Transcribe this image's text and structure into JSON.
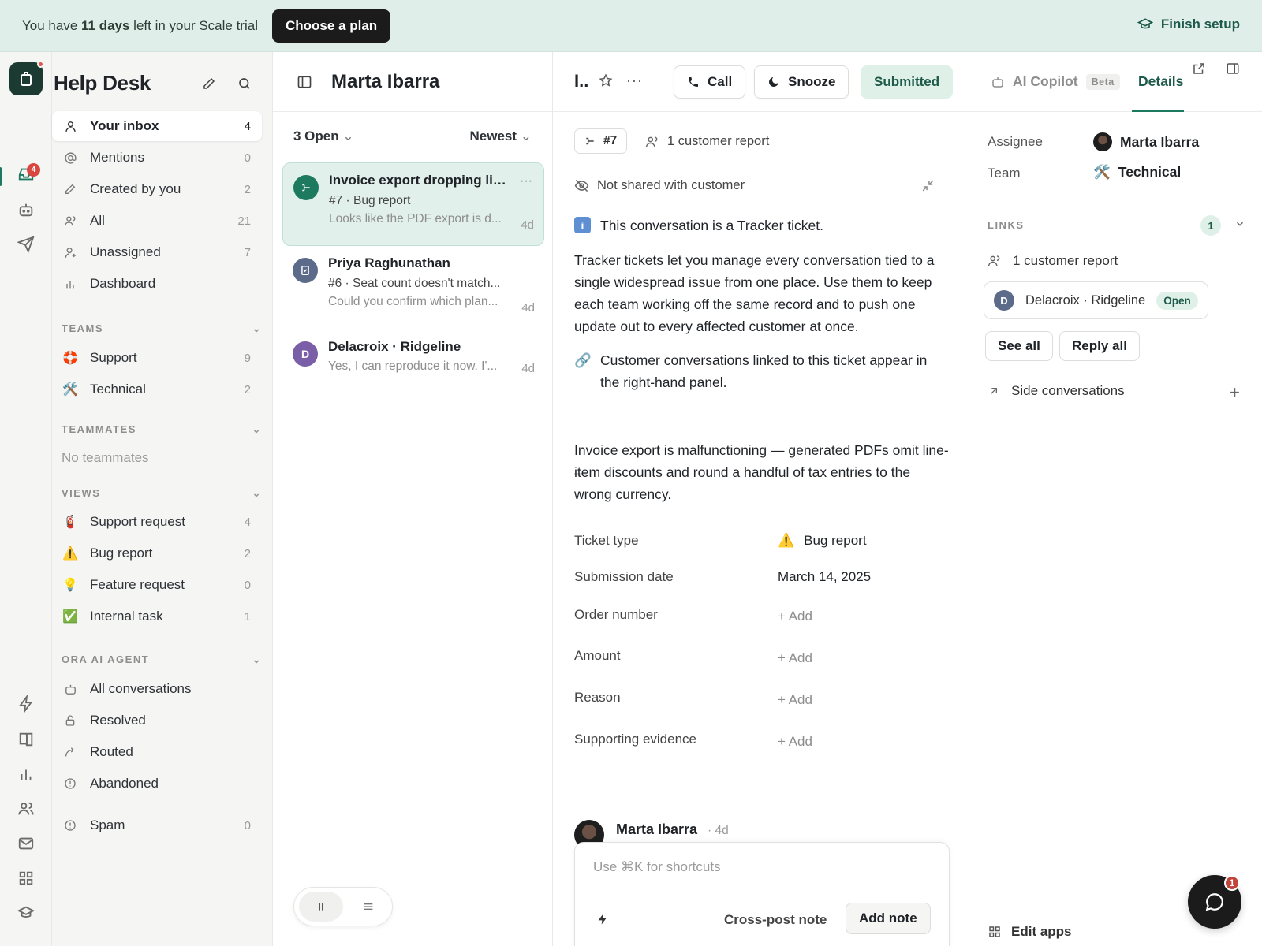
{
  "banner": {
    "prefix": "You have ",
    "days": "11 days",
    "suffix": " left in your Scale trial",
    "choose_plan": "Choose a plan",
    "finish_setup": "Finish setup"
  },
  "rail": {
    "inbox_badge": "4"
  },
  "sidebar": {
    "title": "Help Desk",
    "inbox_items": [
      {
        "label": "Your inbox",
        "count": "4"
      },
      {
        "label": "Mentions",
        "count": "0"
      },
      {
        "label": "Created by you",
        "count": "2"
      },
      {
        "label": "All",
        "count": "21"
      },
      {
        "label": "Unassigned",
        "count": "7"
      },
      {
        "label": "Dashboard",
        "count": ""
      }
    ],
    "teams_heading": "TEAMS",
    "teams": [
      {
        "label": "Support",
        "count": "9",
        "icon": "🛟"
      },
      {
        "label": "Technical",
        "count": "2",
        "icon": "🛠️"
      }
    ],
    "teammates_heading": "TEAMMATES",
    "no_teammates": "No teammates",
    "views_heading": "VIEWS",
    "views": [
      {
        "label": "Support request",
        "count": "4",
        "icon": "🧯"
      },
      {
        "label": "Bug report",
        "count": "2",
        "icon": "⚠️"
      },
      {
        "label": "Feature request",
        "count": "0",
        "icon": "💡"
      },
      {
        "label": "Internal task",
        "count": "1",
        "icon": "✅"
      }
    ],
    "agent_heading": "ORA AI AGENT",
    "agent_items": [
      {
        "label": "All conversations"
      },
      {
        "label": "Resolved"
      },
      {
        "label": "Routed"
      },
      {
        "label": "Abandoned"
      }
    ],
    "spam": {
      "label": "Spam",
      "count": "0"
    }
  },
  "list": {
    "title": "Marta Ibarra",
    "filter_open": "3 Open",
    "filter_sort": "Newest",
    "conversations": [
      {
        "title": "Invoice export dropping lin...",
        "subtitle": "#7 · Bug report",
        "preview": "Looks like the PDF export is d...",
        "age": "4d",
        "avatar": "",
        "avatar_color": "#1e7a5f"
      },
      {
        "title": "Priya Raghunathan",
        "subtitle": "#6 · Seat count doesn't match...",
        "preview": "Could you confirm which plan...",
        "age": "4d",
        "avatar": "",
        "avatar_color": "#5d6b8a"
      },
      {
        "title": "Delacroix · Ridgeline",
        "subtitle": "",
        "preview": "Yes, I can reproduce it now. I'...",
        "age": "4d",
        "avatar": "D",
        "avatar_color": "#7a5fa8"
      }
    ]
  },
  "main": {
    "title": "I..",
    "call": "Call",
    "snooze": "Snooze",
    "submitted": "Submitted",
    "ticket_id": "#7",
    "customer_report": "1 customer report",
    "not_shared": "Not shared with customer",
    "tracker_line": "This conversation is a Tracker ticket.",
    "info_badge": "i",
    "tracker_desc": "Tracker tickets let you manage every conversation tied to a single widespread issue from one place. Use them to keep each team working off the same record and to push one update out to every affected customer at once.",
    "link_note": "Customer conversations linked to this ticket appear in the right-hand panel.",
    "dash": "—",
    "description": "Invoice export is malfunctioning — generated PDFs omit line-item discounts and round a handful of tax entries to the wrong currency.",
    "attributes": [
      {
        "label": "Ticket type",
        "value": "Bug report",
        "icon": "⚠️"
      },
      {
        "label": "Submission date",
        "value": "March 14, 2025"
      },
      {
        "label": "Order number",
        "value": "+ Add"
      },
      {
        "label": "Amount",
        "value": "+ Add"
      },
      {
        "label": "Reason",
        "value": "+ Add"
      },
      {
        "label": "Supporting evidence",
        "value": "+ Add"
      }
    ],
    "message_author": "Marta Ibarra",
    "message_age": "· 4d",
    "composer_placeholder": "Use ⌘K for shortcuts",
    "cross_post": "Cross-post note",
    "add_note": "Add note"
  },
  "details": {
    "tab_copilot": "AI Copilot",
    "beta": "Beta",
    "tab_details": "Details",
    "assignee_label": "Assignee",
    "assignee_value": "Marta Ibarra",
    "team_label": "Team",
    "team_value": "Technical",
    "team_icon": "🛠️",
    "links_heading": "LINKS",
    "links_count": "1",
    "customer_report": "1 customer report",
    "linked_avatar": "D",
    "linked_name": "Delacroix · Ridgeline",
    "linked_status": "Open",
    "see_all": "See all",
    "reply_all": "Reply all",
    "side_conversations": "Side conversations",
    "edit_apps": "Edit apps"
  },
  "messenger": {
    "badge": "1"
  },
  "colors": {
    "accent": "#1e7a5f",
    "banner_bg": "#dfeee9",
    "selected_bg": "#e2f0eb"
  }
}
